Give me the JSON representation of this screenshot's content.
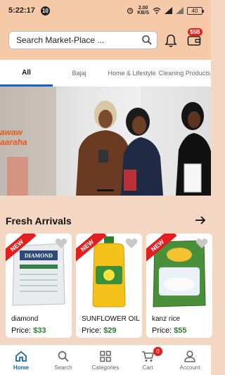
{
  "status_bar": {
    "time": "5:22:17",
    "notification_count": "10",
    "net_speed_value": "2.00",
    "net_speed_unit": "KB/S",
    "battery": "40"
  },
  "header": {
    "search_placeholder": "Search Market-Place ...",
    "wallet_badge": "$5B"
  },
  "tabs": [
    {
      "label": "All",
      "active": true
    },
    {
      "label": "Bajaj",
      "active": false
    },
    {
      "label": "Home & Lifestyle",
      "active": false
    },
    {
      "label": "Cleaning Products",
      "active": false
    }
  ],
  "banner": {
    "promo_text_line1": "awaw",
    "promo_text_line2": "aaraha"
  },
  "section": {
    "title": "Fresh Arrivals"
  },
  "products": [
    {
      "name": "diamond",
      "price_label": "Price:",
      "price": "$33",
      "tag": "NEW"
    },
    {
      "name": "SUNFLOWER OIL",
      "price_label": "Price:",
      "price": "$29",
      "tag": "NEW"
    },
    {
      "name": "kanz rice",
      "price_label": "Price:",
      "price": "$55",
      "tag": "NEW"
    }
  ],
  "bottom_nav": [
    {
      "label": "Home",
      "icon": "home-icon",
      "active": true
    },
    {
      "label": "Search",
      "icon": "search-icon",
      "active": false
    },
    {
      "label": "Categories",
      "icon": "grid-icon",
      "active": false
    },
    {
      "label": "Cart",
      "icon": "cart-icon",
      "active": false,
      "badge": "0"
    },
    {
      "label": "Account",
      "icon": "user-icon",
      "active": false
    }
  ],
  "colors": {
    "header_bg": "#f6c9a8",
    "accent": "#1565c0",
    "badge": "#e41e1e",
    "price": "#2e7d32"
  }
}
